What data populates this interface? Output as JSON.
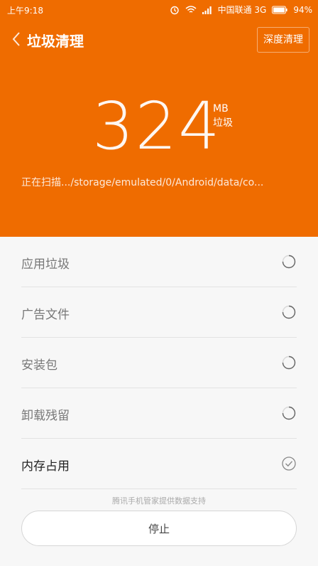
{
  "status_bar": {
    "time": "上午9:18",
    "carrier": "中国联通 3G",
    "battery": "94%"
  },
  "header": {
    "title": "垃圾清理",
    "deep_clean_label": "深度清理"
  },
  "scan": {
    "size_value": "324",
    "size_unit": "MB",
    "size_label": "垃圾",
    "scanning_text": "正在扫描.../storage/emulated/0/Android/data/co..."
  },
  "categories": [
    {
      "label": "应用垃圾",
      "state": "scanning"
    },
    {
      "label": "广告文件",
      "state": "scanning"
    },
    {
      "label": "安装包",
      "state": "scanning"
    },
    {
      "label": "卸载残留",
      "state": "scanning"
    },
    {
      "label": "内存占用",
      "state": "done"
    }
  ],
  "footer": {
    "provider_text": "腾讯手机管家提供数据支持",
    "stop_label": "停止"
  },
  "colors": {
    "accent": "#ef6c00",
    "background": "#f7f7f7"
  }
}
